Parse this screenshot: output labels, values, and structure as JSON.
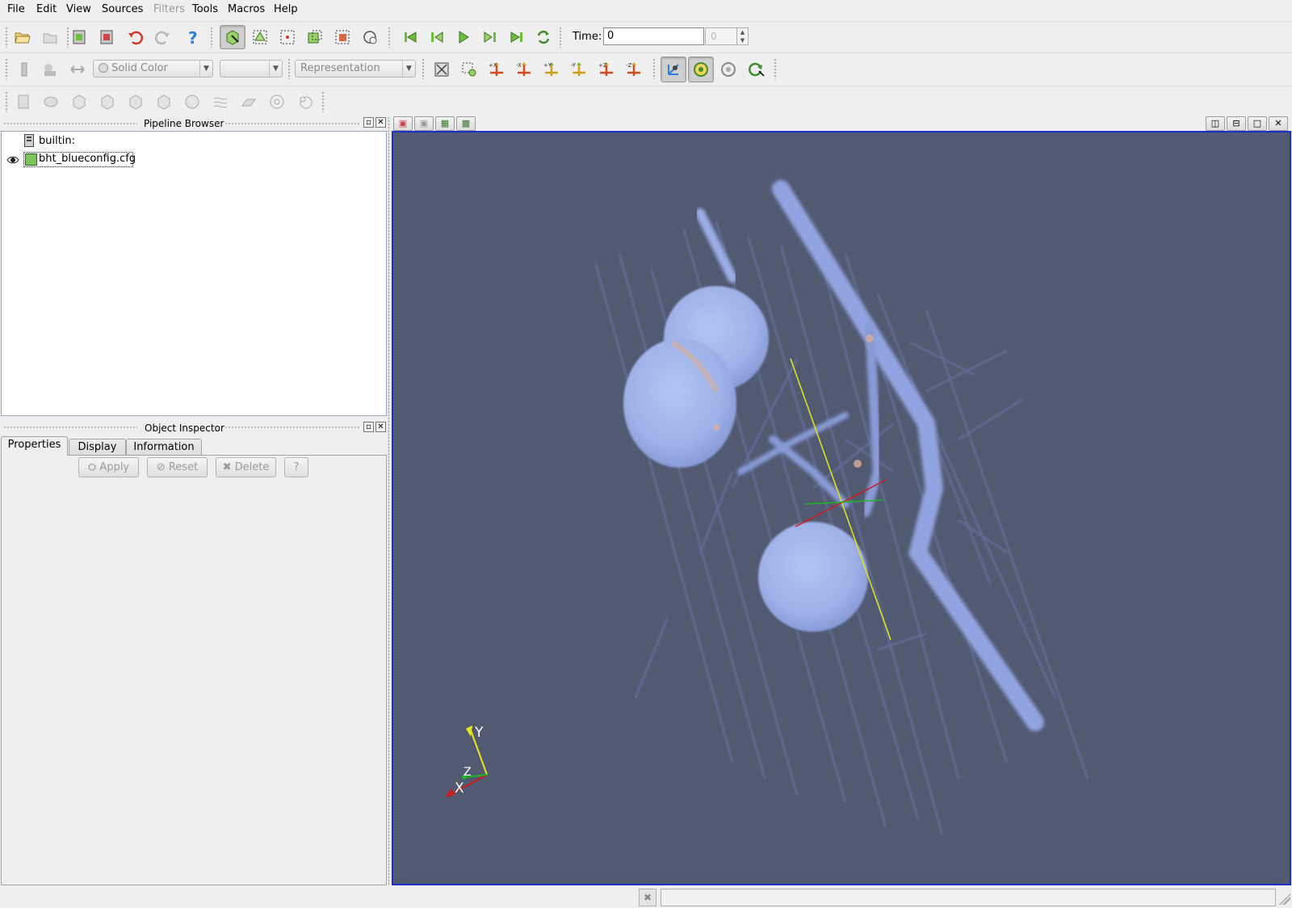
{
  "menu": [
    "File",
    "Edit",
    "View",
    "Sources",
    "Filters",
    "Tools",
    "Macros",
    "Help"
  ],
  "menu_disabled": [
    "Filters"
  ],
  "time": {
    "label": "Time:",
    "value": "0",
    "spin_value": "0"
  },
  "combos": {
    "color_by": "Solid Color",
    "component": "",
    "representation": "Representation"
  },
  "camera_buttons": [
    "+X",
    "-X",
    "+Y",
    "-Y",
    "+Z",
    "-Z"
  ],
  "pipeline_browser": {
    "title": "Pipeline Browser",
    "items": [
      {
        "label": "builtin:",
        "icon": "server-icon"
      },
      {
        "label": "bht_blueconfig.cfg",
        "icon": "green-cube-icon",
        "visible": true
      }
    ]
  },
  "object_inspector": {
    "title": "Object Inspector",
    "tabs": [
      "Properties",
      "Display",
      "Information"
    ],
    "active_tab": "Properties",
    "buttons": {
      "apply": "Apply",
      "reset": "Reset",
      "delete": "Delete",
      "help": "?"
    }
  },
  "axes_labels": {
    "x": "X",
    "y": "Y",
    "z": "Z"
  },
  "colors": {
    "view_background": "#525a72",
    "view_border": "#1d2ecb",
    "structure": "#a9bdfa",
    "axis_x": "#d01a1a",
    "axis_y": "#e6e618",
    "axis_z": "#21b521"
  }
}
